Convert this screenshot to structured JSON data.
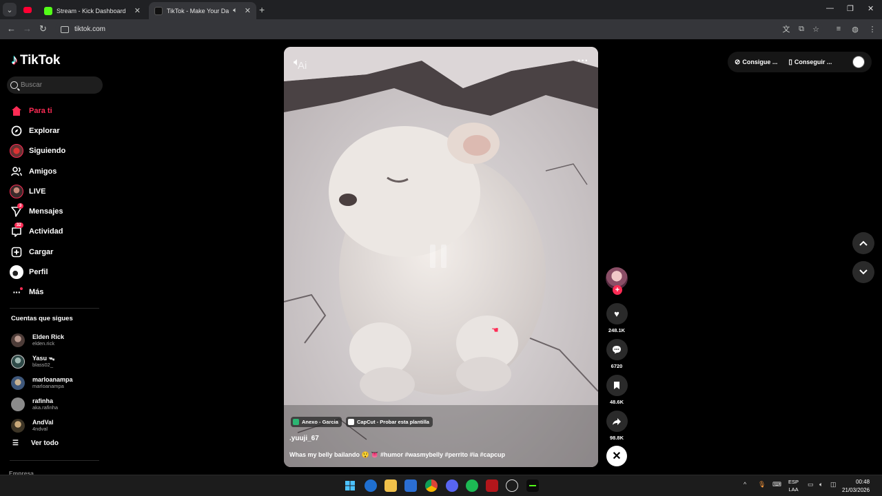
{
  "browser": {
    "tabs": [
      {
        "title": "Stream - Kick Dashboard",
        "favicon_color": "#53fc18"
      },
      {
        "title": "TikTok - Make Your Day",
        "favicon_color": "#000000"
      }
    ],
    "url": "tiktok.com"
  },
  "sidebar": {
    "logo": "TikTok",
    "search_placeholder": "Buscar",
    "nav": [
      {
        "label": "Para ti",
        "icon": "home-icon"
      },
      {
        "label": "Explorar",
        "icon": "compass-icon"
      },
      {
        "label": "Siguiendo",
        "icon": "following-avatar-icon"
      },
      {
        "label": "Amigos",
        "icon": "friends-icon"
      },
      {
        "label": "LIVE",
        "icon": "live-avatar-icon"
      },
      {
        "label": "Mensajes",
        "icon": "send-icon",
        "badge": "3"
      },
      {
        "label": "Actividad",
        "icon": "inbox-icon",
        "badge": "32"
      },
      {
        "label": "Cargar",
        "icon": "upload-icon"
      },
      {
        "label": "Perfil",
        "icon": "profile-avatar-icon"
      },
      {
        "label": "Más",
        "icon": "more-icon"
      }
    ],
    "following_title": "Cuentas que sigues",
    "following": [
      {
        "name": "Elden Rick",
        "handle": "elden.rick",
        "color": "#6b5a55"
      },
      {
        "name": "Yasu ᯓ",
        "handle": "blass02_",
        "color": "#4a6a6a"
      },
      {
        "name": "marloanampa",
        "handle": "marloanampa",
        "color": "#5a6f8c"
      },
      {
        "name": "rafinha",
        "handle": "aka.rafinha",
        "color": "#7a7a7a"
      },
      {
        "name": "AndVal",
        "handle": "4ndval",
        "color": "#6e6450"
      }
    ],
    "see_all": "Ver todo",
    "footer_section": "Empresa"
  },
  "video": {
    "chips": [
      {
        "label": "Anexo - Garcia",
        "color": "#2bb673"
      },
      {
        "label": "CapCut - Probar esta plantilla",
        "color": "#ffffff"
      }
    ],
    "username": ".yuuji_67",
    "caption": "Whas my belly bailando 😲 👅",
    "hashtags": "#humor #wasmybelly #perrito #ia #capcup",
    "ai_label": "Ai"
  },
  "actions": {
    "likes": "248.1K",
    "comments": "6720",
    "saves": "48.6K",
    "shares": "98.8K"
  },
  "top_right": {
    "coins_label": "Consigue ...",
    "app_label": "Conseguir ..."
  },
  "taskbar": {
    "lang_top": "ESP",
    "lang_bottom": "LAA",
    "time": "00:48",
    "date": "21/03/2026"
  }
}
